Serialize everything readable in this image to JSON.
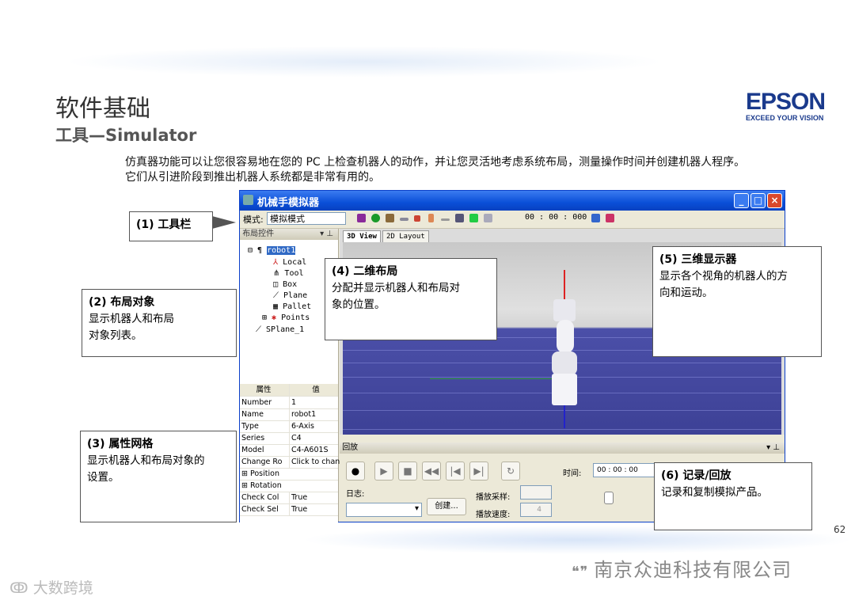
{
  "slide": {
    "title": "软件基础",
    "subtitle": "工具—Simulator",
    "intro_line1": "仿真器功能可以让您很容易地在您的 PC 上检查机器人的动作，并让您灵活地考虑系统布局，测量操作时间并创建机器人程序。",
    "intro_line2": "它们从引进阶段到推出机器人系统都是非常有用的。",
    "page_number": "62",
    "logo_brand": "EPSON",
    "logo_tagline": "EXCEED YOUR VISION",
    "footer_company": "南京众迪科技有限公司",
    "footer_watermark": "大数跨境"
  },
  "window": {
    "title": "机械手模拟器",
    "toolbar": {
      "mode_label": "模式:",
      "mode_value": "模拟模式",
      "time": "00 : 00 : 000"
    },
    "layout_panel": {
      "header": "布局控件",
      "tree": [
        "robot1",
        "Local",
        "Tool",
        "Box",
        "Plane",
        "Pallet",
        "Points",
        "SPlane_1"
      ]
    },
    "properties": {
      "col_property": "属性",
      "col_value": "值",
      "rows": [
        {
          "k": "Number",
          "v": "1"
        },
        {
          "k": "Name",
          "v": "robot1"
        },
        {
          "k": "Type",
          "v": "6-Axis"
        },
        {
          "k": "Series",
          "v": "C4"
        },
        {
          "k": "Model",
          "v": "C4-A601S"
        },
        {
          "k": "Change Ro",
          "v": "Click to chang"
        },
        {
          "k": "Position",
          "v": ""
        },
        {
          "k": "Rotation",
          "v": ""
        },
        {
          "k": "Check Col",
          "v": "True"
        },
        {
          "k": "Check Sel",
          "v": "True"
        }
      ]
    },
    "tabs": [
      "3D View",
      "2D Layout"
    ],
    "playback": {
      "header": "回放",
      "log_label": "日志:",
      "create_button": "创建...",
      "sampling_label": "播放采样:",
      "speed_label": "播放速度:",
      "speed_value": "4",
      "time_label": "时间:",
      "time_value": "00 : 00 : 00"
    }
  },
  "callouts": {
    "c1": {
      "heading": "(1) 工具栏",
      "body": ""
    },
    "c2": {
      "heading": "(2) 布局对象",
      "body1": "显示机器人和布局",
      "body2": "对象列表。"
    },
    "c3": {
      "heading": "(3) 属性网格",
      "body1": "显示机器人和布局对象的",
      "body2": "设置。"
    },
    "c4": {
      "heading": "(4) 二维布局",
      "body1": "分配并显示机器人和布局对",
      "body2": "象的位置。"
    },
    "c5": {
      "heading": "(5) 三维显示器",
      "body1": "显示各个视角的机器人的方",
      "body2": "向和运动。"
    },
    "c6": {
      "heading": "(6) 记录/回放",
      "body1": "记录和复制模拟产品。"
    }
  },
  "colors": {
    "accent": "#1a3a8c",
    "titlebar": "#0a4fd8",
    "floor": "#4b4fa8"
  }
}
